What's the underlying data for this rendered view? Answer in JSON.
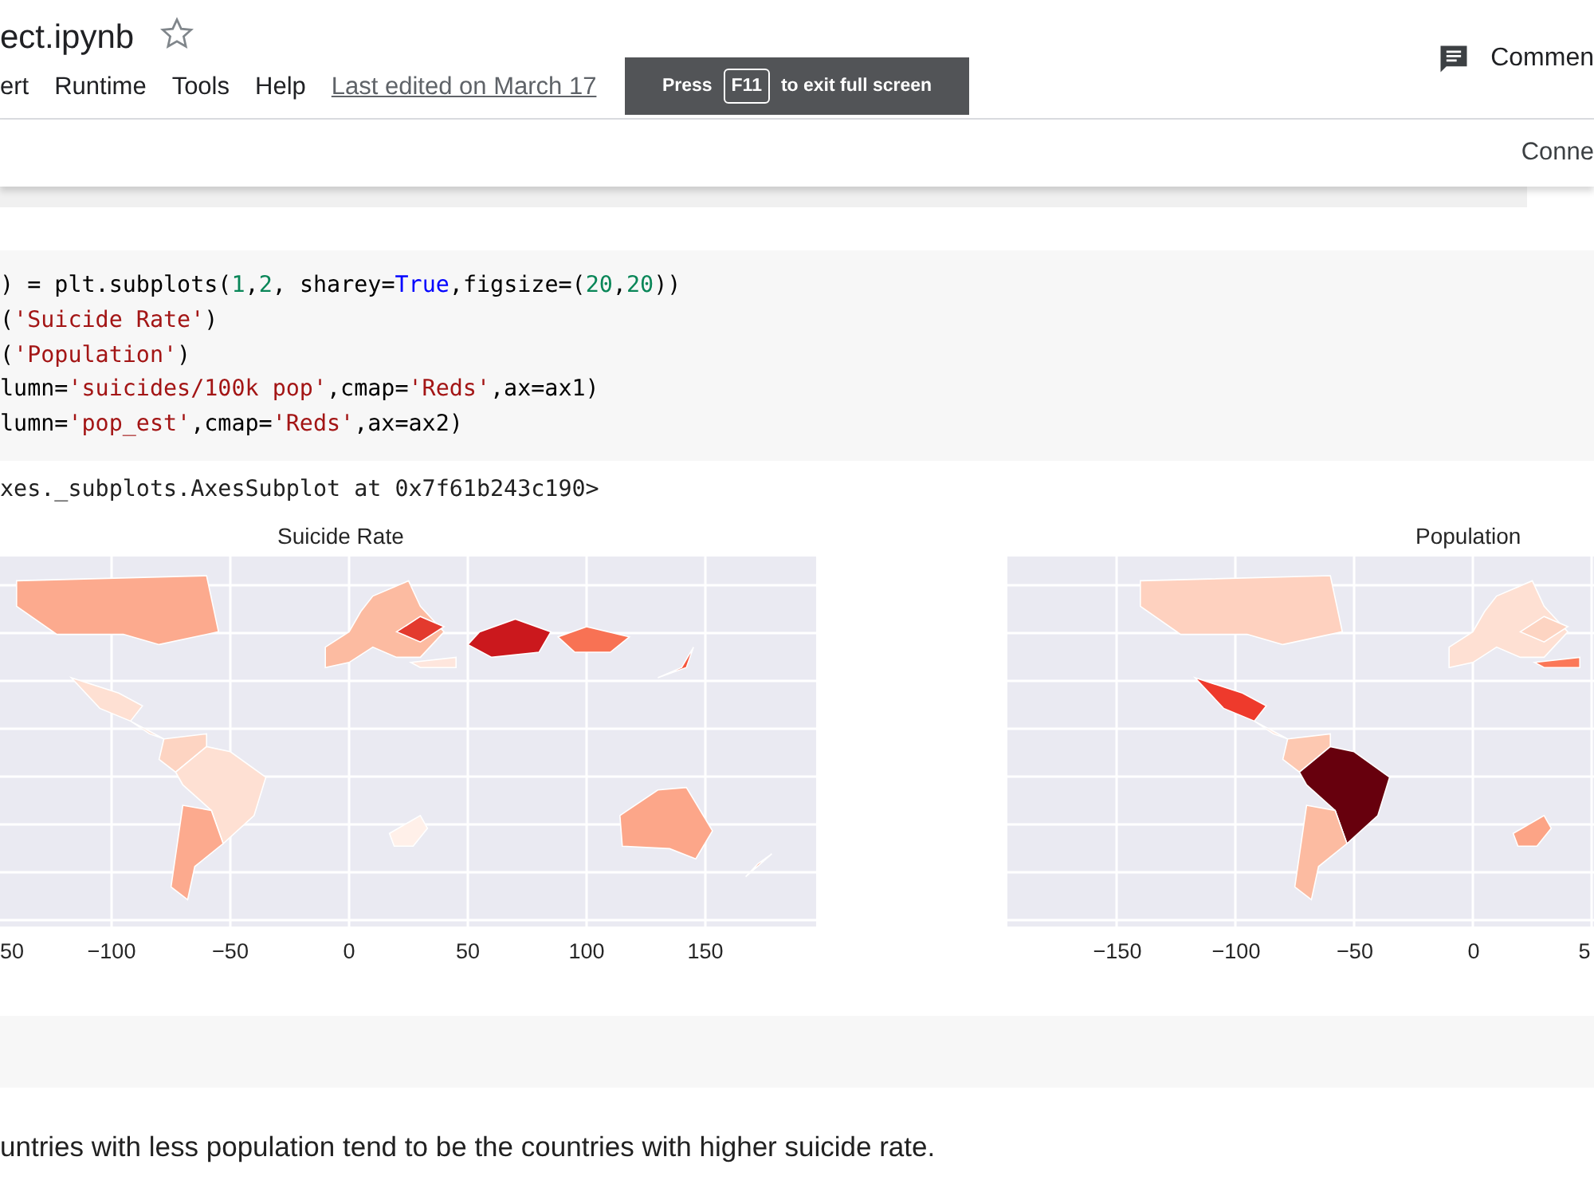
{
  "header": {
    "title": "ect.ipynb",
    "starred": false,
    "menu": [
      "ert",
      "Runtime",
      "Tools",
      "Help"
    ],
    "last_edited": "Last edited on March 17",
    "comment_label": "Commen"
  },
  "fullscreen_toast": {
    "before": "Press",
    "key": "F11",
    "after": "to exit full screen"
  },
  "toolbar": {
    "connect_label": "Conne"
  },
  "code_cell": {
    "lines": [
      [
        {
          "kind": "plain",
          "text": ") = plt.subplots("
        },
        {
          "kind": "number",
          "text": "1"
        },
        {
          "kind": "plain",
          "text": ","
        },
        {
          "kind": "number",
          "text": "2"
        },
        {
          "kind": "plain",
          "text": ", sharey="
        },
        {
          "kind": "keyword",
          "text": "True"
        },
        {
          "kind": "plain",
          "text": ",figsize=("
        },
        {
          "kind": "number",
          "text": "20"
        },
        {
          "kind": "plain",
          "text": ","
        },
        {
          "kind": "number",
          "text": "20"
        },
        {
          "kind": "plain",
          "text": "))"
        }
      ],
      [
        {
          "kind": "plain",
          "text": "("
        },
        {
          "kind": "string",
          "text": "'Suicide Rate'"
        },
        {
          "kind": "plain",
          "text": ")"
        }
      ],
      [
        {
          "kind": "plain",
          "text": "("
        },
        {
          "kind": "string",
          "text": "'Population'"
        },
        {
          "kind": "plain",
          "text": ")"
        }
      ],
      [
        {
          "kind": "plain",
          "text": "lumn="
        },
        {
          "kind": "string",
          "text": "'suicides/100k pop'"
        },
        {
          "kind": "plain",
          "text": ",cmap="
        },
        {
          "kind": "string",
          "text": "'Reds'"
        },
        {
          "kind": "plain",
          "text": ",ax=ax1)"
        }
      ],
      [
        {
          "kind": "plain",
          "text": "lumn="
        },
        {
          "kind": "string",
          "text": "'pop_est'"
        },
        {
          "kind": "plain",
          "text": ",cmap="
        },
        {
          "kind": "string",
          "text": "'Reds'"
        },
        {
          "kind": "plain",
          "text": ",ax=ax2)"
        }
      ]
    ],
    "output": "xes._subplots.AxesSubplot at 0x7f61b243c190>"
  },
  "maps": [
    {
      "title": "Suicide Rate",
      "x_ticks": [
        "50",
        "−100",
        "−50",
        "0",
        "50",
        "100",
        "150"
      ]
    },
    {
      "title": "Population",
      "x_ticks": [
        "−150",
        "−100",
        "−50",
        "0",
        "5"
      ]
    }
  ],
  "text_cell": "untries with less population tend to be the countries with higher suicide rate."
}
